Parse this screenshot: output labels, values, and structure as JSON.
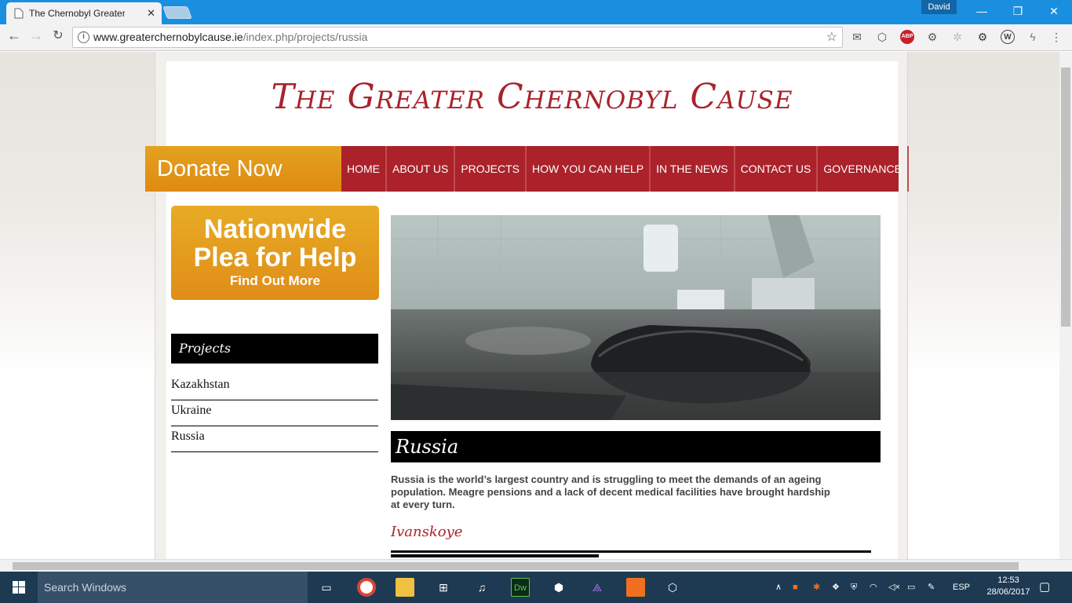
{
  "browser": {
    "tab_title": "The Chernobyl Greater C",
    "user": "David",
    "url_host": "www.greaterchernobylcause.ie",
    "url_path": "/index.php/projects/russia"
  },
  "site": {
    "title": "The Greater Chernobyl Cause",
    "donate": "Donate Now",
    "menu": [
      "HOME",
      "ABOUT US",
      "PROJECTS",
      "HOW YOU CAN HELP",
      "IN THE NEWS",
      "CONTACT US",
      "GOVERNANCE"
    ],
    "plea_line1": "Nationwide",
    "plea_line2": "Plea for Help",
    "plea_cta": "Find Out More",
    "sidebar_heading": "Projects",
    "sidebar_items": [
      "Kazakhstan",
      "Ukraine",
      "Russia"
    ],
    "page_heading": "Russia",
    "intro": "Russia is the world’s largest country and is struggling to meet the demands of an ageing population. Meagre pensions and a lack of decent medical facilities have brought hardship at every turn.",
    "subheading": "Ivanskoye"
  },
  "taskbar": {
    "search_placeholder": "Search Windows",
    "lang": "ESP",
    "time": "12:53",
    "date": "28/06/2017"
  }
}
